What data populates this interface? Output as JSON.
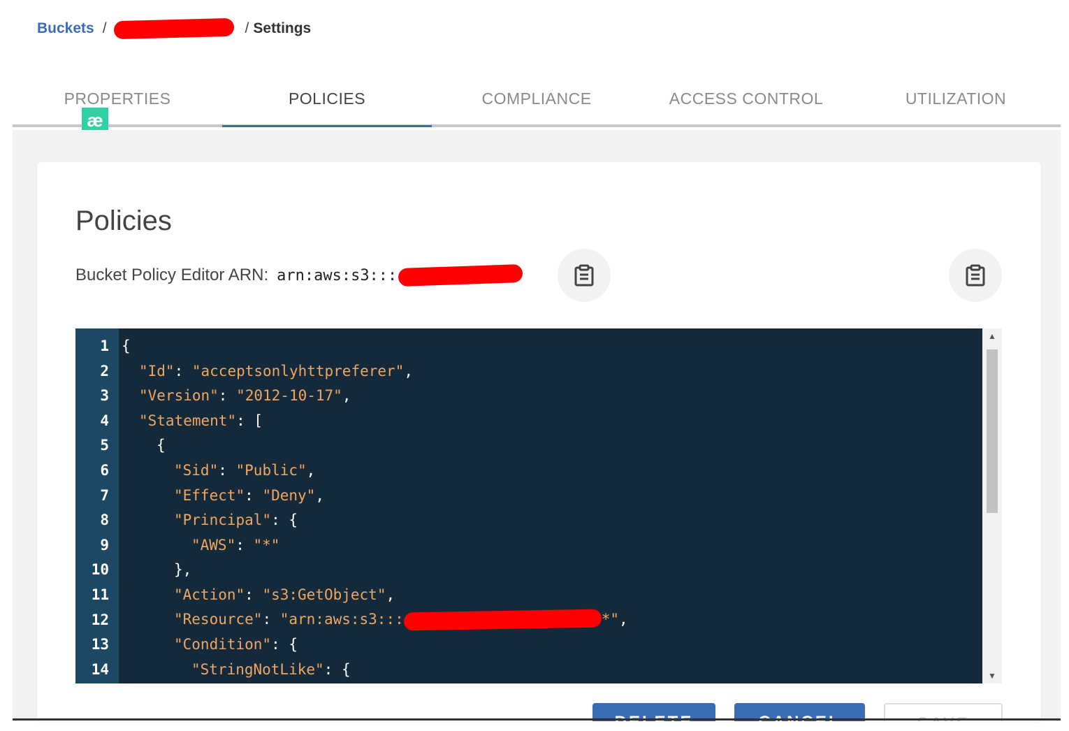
{
  "breadcrumb": {
    "root": "Buckets",
    "current": "Settings"
  },
  "tabs": [
    {
      "label": "PROPERTIES",
      "active": false
    },
    {
      "label": "POLICIES",
      "active": true
    },
    {
      "label": "COMPLIANCE",
      "active": false
    },
    {
      "label": "ACCESS CONTROL",
      "active": false
    },
    {
      "label": "UTILIZATION",
      "active": false
    }
  ],
  "badge": {
    "text": "æ"
  },
  "policies": {
    "title": "Policies",
    "arn_label": "Bucket Policy Editor ARN:",
    "arn_prefix": "arn:aws:s3:::"
  },
  "editor": {
    "lines": [
      {
        "num": "1",
        "indent": 0,
        "tokens": [
          [
            "p",
            "{"
          ]
        ]
      },
      {
        "num": "2",
        "indent": 1,
        "tokens": [
          [
            "k",
            "\"Id\""
          ],
          [
            "p",
            ": "
          ],
          [
            "s",
            "\"acceptsonlyhttpreferer\""
          ],
          [
            "p",
            ","
          ]
        ]
      },
      {
        "num": "3",
        "indent": 1,
        "tokens": [
          [
            "k",
            "\"Version\""
          ],
          [
            "p",
            ": "
          ],
          [
            "s",
            "\"2012-10-17\""
          ],
          [
            "p",
            ","
          ]
        ]
      },
      {
        "num": "4",
        "indent": 1,
        "tokens": [
          [
            "k",
            "\"Statement\""
          ],
          [
            "p",
            ": ["
          ]
        ]
      },
      {
        "num": "5",
        "indent": 2,
        "tokens": [
          [
            "p",
            "{"
          ]
        ]
      },
      {
        "num": "6",
        "indent": 3,
        "tokens": [
          [
            "k",
            "\"Sid\""
          ],
          [
            "p",
            ": "
          ],
          [
            "s",
            "\"Public\""
          ],
          [
            "p",
            ","
          ]
        ]
      },
      {
        "num": "7",
        "indent": 3,
        "tokens": [
          [
            "k",
            "\"Effect\""
          ],
          [
            "p",
            ": "
          ],
          [
            "s",
            "\"Deny\""
          ],
          [
            "p",
            ","
          ]
        ]
      },
      {
        "num": "8",
        "indent": 3,
        "tokens": [
          [
            "k",
            "\"Principal\""
          ],
          [
            "p",
            ": {"
          ]
        ]
      },
      {
        "num": "9",
        "indent": 4,
        "tokens": [
          [
            "k",
            "\"AWS\""
          ],
          [
            "p",
            ": "
          ],
          [
            "s",
            "\"*\""
          ]
        ]
      },
      {
        "num": "10",
        "indent": 3,
        "tokens": [
          [
            "p",
            "},"
          ]
        ]
      },
      {
        "num": "11",
        "indent": 3,
        "tokens": [
          [
            "k",
            "\"Action\""
          ],
          [
            "p",
            ": "
          ],
          [
            "s",
            "\"s3:GetObject\""
          ],
          [
            "p",
            ","
          ]
        ]
      },
      {
        "num": "12",
        "indent": 3,
        "tokens": [
          [
            "k",
            "\"Resource\""
          ],
          [
            "p",
            ": "
          ],
          [
            "s",
            "\"arn:aws:s3:::"
          ],
          [
            "r",
            ""
          ],
          [
            "s",
            "*\""
          ],
          [
            "p",
            ","
          ]
        ]
      },
      {
        "num": "13",
        "indent": 3,
        "tokens": [
          [
            "k",
            "\"Condition\""
          ],
          [
            "p",
            ": {"
          ]
        ]
      },
      {
        "num": "14",
        "indent": 4,
        "tokens": [
          [
            "k",
            "\"StringNotLike\""
          ],
          [
            "p",
            ": {"
          ]
        ]
      }
    ]
  },
  "buttons": {
    "delete": "DELETE",
    "cancel": "CANCEL",
    "save": "SAVE"
  },
  "colors": {
    "accent": "#3a6db5",
    "editor_bg": "#142a3b",
    "gutter_bg": "#1d4863",
    "string": "#f0a561",
    "badge": "#2fd0a4",
    "redaction": "#ff0000"
  },
  "icons": {
    "copy": "clipboard-icon"
  }
}
